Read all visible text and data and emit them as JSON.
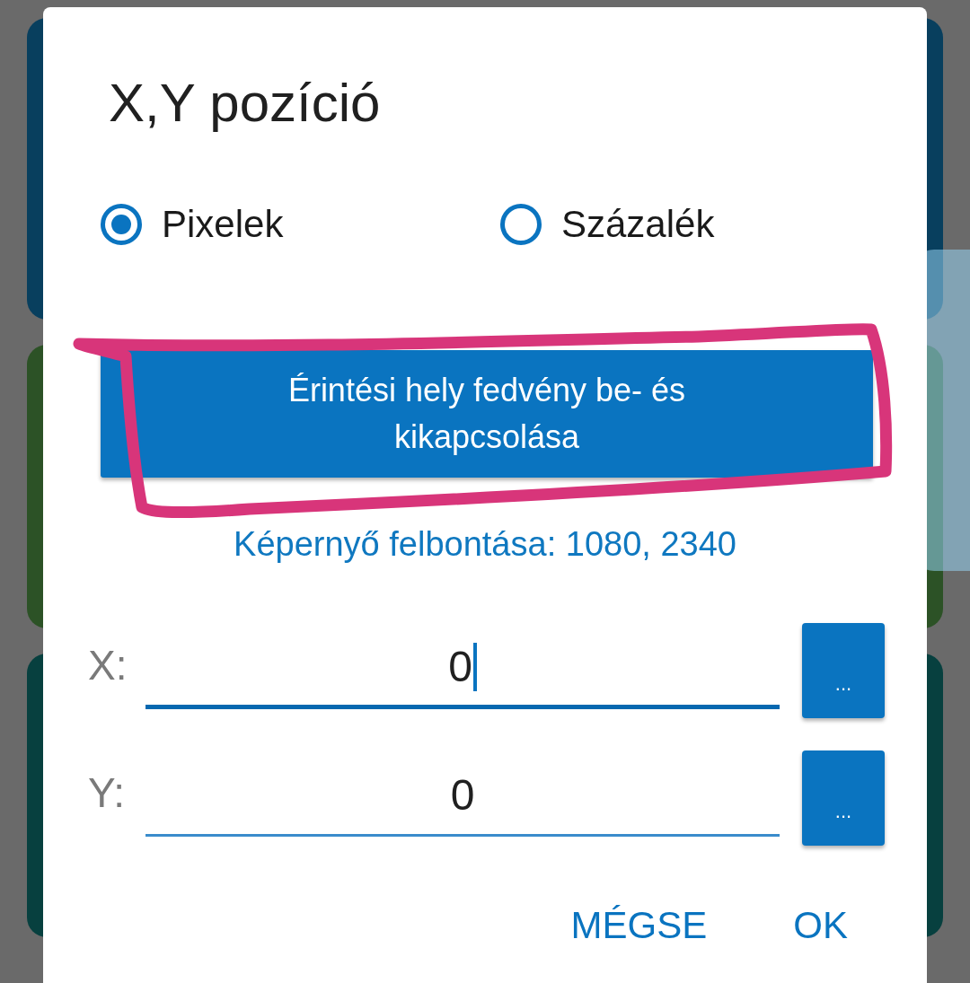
{
  "dialog": {
    "title": "X,Y pozíció",
    "units": [
      {
        "label": "Pixelek",
        "selected": true
      },
      {
        "label": "Százalék",
        "selected": false
      }
    ],
    "toggle_button": "Érintési hely fedvény be- és kikapcsolása",
    "resolution": "Képernyő felbontása: 1080, 2340",
    "fields": [
      {
        "label": "X:",
        "value": "0",
        "focused": true,
        "button": "..."
      },
      {
        "label": "Y:",
        "value": "0",
        "focused": false,
        "button": "..."
      }
    ],
    "actions": [
      "MÉGSE",
      "OK"
    ]
  }
}
